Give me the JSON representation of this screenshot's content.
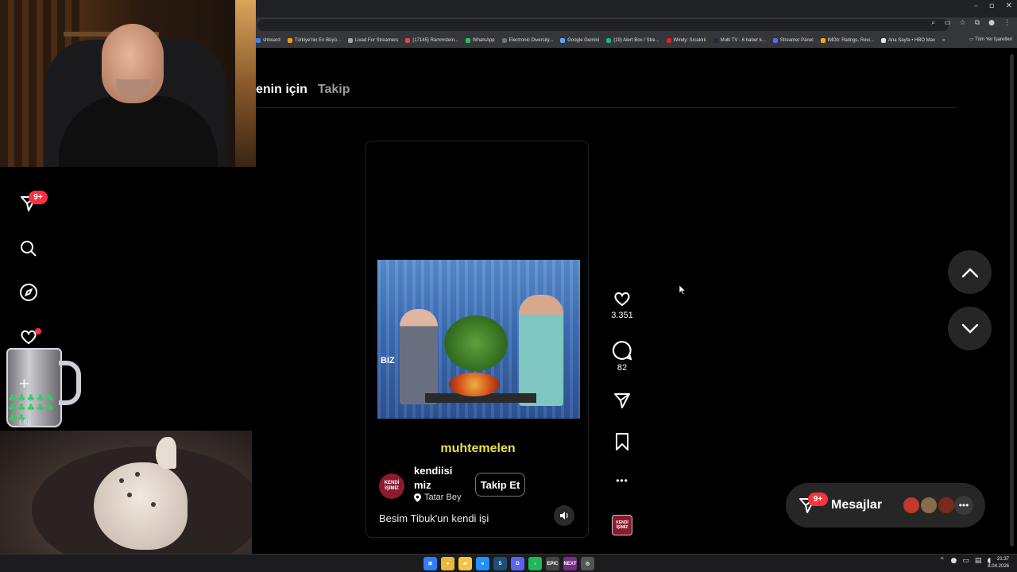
{
  "browser": {
    "window_controls": [
      "–",
      "▫",
      "✕"
    ],
    "bookmarks": [
      {
        "label": "shboard",
        "color": "#3b82f6"
      },
      {
        "label": "Türkiye'nin En Büyü...",
        "color": "#f59e0b"
      },
      {
        "label": "Livad For Streamers",
        "color": "#a3a3a3"
      },
      {
        "label": "(17145) Rammstein...",
        "color": "#ef4444"
      },
      {
        "label": "WhatsApp",
        "color": "#22c55e"
      },
      {
        "label": "Electronic Diversity...",
        "color": "#737373"
      },
      {
        "label": "Google Gemini",
        "color": "#60a5fa"
      },
      {
        "label": "(19) Alert Box / Stre...",
        "color": "#10b981"
      },
      {
        "label": "Windy: Sıcaklık",
        "color": "#dc2626"
      },
      {
        "label": "Multi TV - 6 haber k...",
        "color": "#1f2937"
      },
      {
        "label": "Streamer Panel",
        "color": "#6366f1"
      },
      {
        "label": "IMDb: Ratings, Revi...",
        "color": "#eab308"
      },
      {
        "label": "Ana Sayfa • HBO Max",
        "color": "#e5e5e5"
      }
    ],
    "bookmarks_overflow": "»",
    "all_bookmarks": "Tüm Yer İşaretleri"
  },
  "feed": {
    "tabs": [
      {
        "label": "enin için",
        "active": true
      },
      {
        "label": "Takip",
        "active": false
      }
    ]
  },
  "sidebar": {
    "notification_badge": "9+",
    "items": [
      {
        "name": "messages-direct",
        "icon": "send-icon"
      },
      {
        "name": "search",
        "icon": "search-icon"
      },
      {
        "name": "explore",
        "icon": "compass-icon"
      },
      {
        "name": "notifications",
        "icon": "heart-icon"
      }
    ]
  },
  "overlays": {
    "mug_label": "l.llll"
  },
  "video": {
    "biz_logo": "BIZ",
    "caption": "muhtemelen",
    "author": {
      "name_line1": "kendiisi",
      "name_line2": "miz",
      "avatar_text_1": "KENDİ",
      "avatar_text_2": "İŞİMİZ",
      "location": "Tatar Bey"
    },
    "follow_label": "Takip Et",
    "description": "Besim Tibuk'un kendi işi"
  },
  "actions": {
    "likes": "3.351",
    "comments": "82",
    "more": "•••",
    "audio_thumb_text": "KENDİ İŞİMİZ"
  },
  "messages": {
    "label": "Mesajlar",
    "badge": "9+",
    "more": "•••",
    "avatars": [
      "#c0392b",
      "#8b6a4a",
      "#7a2a1a"
    ]
  },
  "taskbar": {
    "apps": [
      {
        "name": "start",
        "color": "#2d7ff9",
        "glyph": "⊞"
      },
      {
        "name": "chrome",
        "color": "#e8b93a",
        "glyph": "●"
      },
      {
        "name": "explorer",
        "color": "#f4c542",
        "glyph": "▰"
      },
      {
        "name": "edge",
        "color": "#1e90ff",
        "glyph": "e"
      },
      {
        "name": "steam",
        "color": "#1b4f7a",
        "glyph": "S"
      },
      {
        "name": "discord",
        "color": "#5865f2",
        "glyph": "D"
      },
      {
        "name": "spotify",
        "color": "#1db954",
        "glyph": "♪"
      },
      {
        "name": "epic",
        "color": "#444444",
        "glyph": "EPIC"
      },
      {
        "name": "next",
        "color": "#7a2a8a",
        "glyph": "NEXT"
      },
      {
        "name": "other",
        "color": "#555555",
        "glyph": "◎"
      }
    ],
    "time": "21:37",
    "date": "8.04.2026"
  }
}
